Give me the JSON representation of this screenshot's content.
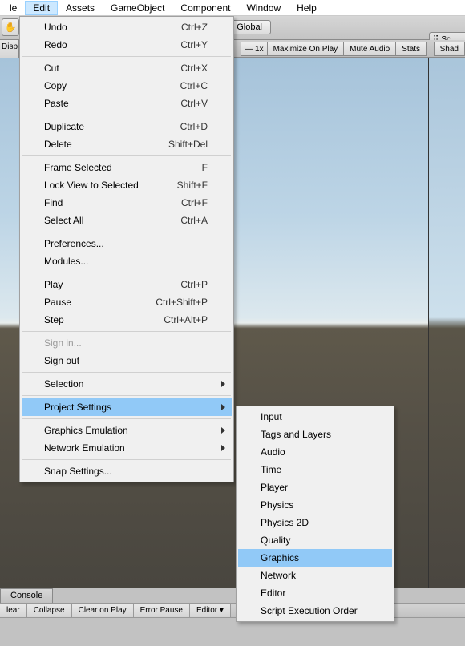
{
  "menubar": {
    "items": [
      {
        "label": "le",
        "active": false
      },
      {
        "label": "Edit",
        "active": true
      },
      {
        "label": "Assets",
        "active": false
      },
      {
        "label": "GameObject",
        "active": false
      },
      {
        "label": "Component",
        "active": false
      },
      {
        "label": "Window",
        "active": false
      },
      {
        "label": "Help",
        "active": false
      }
    ]
  },
  "toolbar": {
    "global": "Global",
    "disp": "Disp",
    "one_x": "1x",
    "maximize": "Maximize On Play",
    "mute": "Mute Audio",
    "stats": "Stats",
    "scene_right": "Sc",
    "shad": "Shad"
  },
  "edit_menu": [
    {
      "type": "item",
      "label": "Undo",
      "shortcut": "Ctrl+Z"
    },
    {
      "type": "item",
      "label": "Redo",
      "shortcut": "Ctrl+Y"
    },
    {
      "type": "sep"
    },
    {
      "type": "item",
      "label": "Cut",
      "shortcut": "Ctrl+X"
    },
    {
      "type": "item",
      "label": "Copy",
      "shortcut": "Ctrl+C"
    },
    {
      "type": "item",
      "label": "Paste",
      "shortcut": "Ctrl+V"
    },
    {
      "type": "sep"
    },
    {
      "type": "item",
      "label": "Duplicate",
      "shortcut": "Ctrl+D"
    },
    {
      "type": "item",
      "label": "Delete",
      "shortcut": "Shift+Del"
    },
    {
      "type": "sep"
    },
    {
      "type": "item",
      "label": "Frame Selected",
      "shortcut": "F"
    },
    {
      "type": "item",
      "label": "Lock View to Selected",
      "shortcut": "Shift+F"
    },
    {
      "type": "item",
      "label": "Find",
      "shortcut": "Ctrl+F"
    },
    {
      "type": "item",
      "label": "Select All",
      "shortcut": "Ctrl+A"
    },
    {
      "type": "sep"
    },
    {
      "type": "item",
      "label": "Preferences..."
    },
    {
      "type": "item",
      "label": "Modules..."
    },
    {
      "type": "sep"
    },
    {
      "type": "item",
      "label": "Play",
      "shortcut": "Ctrl+P"
    },
    {
      "type": "item",
      "label": "Pause",
      "shortcut": "Ctrl+Shift+P"
    },
    {
      "type": "item",
      "label": "Step",
      "shortcut": "Ctrl+Alt+P"
    },
    {
      "type": "sep"
    },
    {
      "type": "item",
      "label": "Sign in...",
      "disabled": true
    },
    {
      "type": "item",
      "label": "Sign out"
    },
    {
      "type": "sep"
    },
    {
      "type": "item",
      "label": "Selection",
      "submenu": true
    },
    {
      "type": "sep"
    },
    {
      "type": "item",
      "label": "Project Settings",
      "submenu": true,
      "highlight": true
    },
    {
      "type": "sep"
    },
    {
      "type": "item",
      "label": "Graphics Emulation",
      "submenu": true
    },
    {
      "type": "item",
      "label": "Network Emulation",
      "submenu": true
    },
    {
      "type": "sep"
    },
    {
      "type": "item",
      "label": "Snap Settings..."
    }
  ],
  "project_settings_menu": [
    {
      "label": "Input"
    },
    {
      "label": "Tags and Layers"
    },
    {
      "label": "Audio"
    },
    {
      "label": "Time"
    },
    {
      "label": "Player"
    },
    {
      "label": "Physics"
    },
    {
      "label": "Physics 2D"
    },
    {
      "label": "Quality"
    },
    {
      "label": "Graphics",
      "highlight": true
    },
    {
      "label": "Network"
    },
    {
      "label": "Editor"
    },
    {
      "label": "Script Execution Order"
    }
  ],
  "console": {
    "tab": "Console",
    "buttons": [
      "lear",
      "Collapse",
      "Clear on Play",
      "Error Pause",
      "Editor ▾"
    ]
  }
}
